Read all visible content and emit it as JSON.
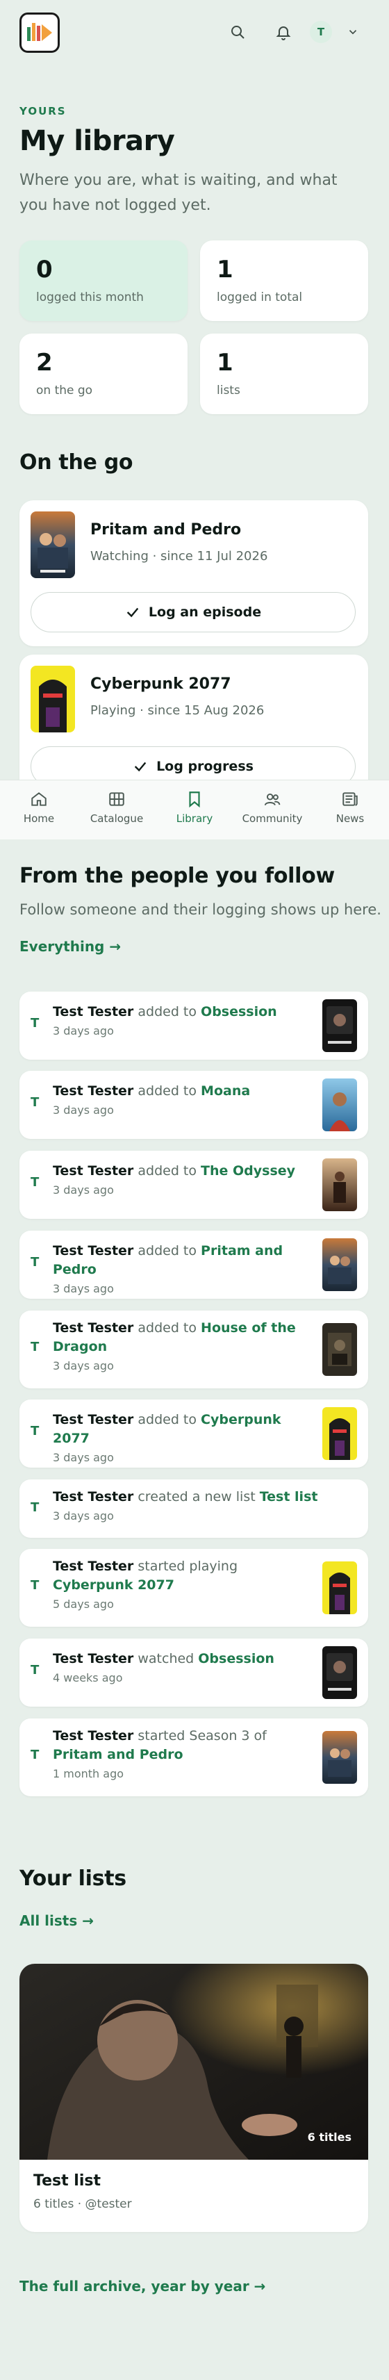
{
  "header": {
    "avatar_initial": "T",
    "icons": [
      "search-icon",
      "bell-icon",
      "chevron-down-icon"
    ]
  },
  "library": {
    "eyebrow": "YOURS",
    "title": "My library",
    "intro": "Where you are, what is waiting, and what you have not logged yet.",
    "stats": [
      {
        "value": "0",
        "label": "logged this month"
      },
      {
        "value": "1",
        "label": "logged in total"
      },
      {
        "value": "2",
        "label": "on the go"
      },
      {
        "value": "1",
        "label": "lists"
      }
    ]
  },
  "on_the_go": {
    "title": "On the go",
    "items": [
      {
        "title": "Pritam and Pedro",
        "meta": "Watching · since 11 Jul 2026",
        "button": "Log an episode"
      },
      {
        "title": "Cyberpunk 2077",
        "meta": "Playing · since 15 Aug 2026",
        "button": "Log progress"
      }
    ]
  },
  "nav": {
    "items": [
      {
        "label": "Home",
        "icon": "home-icon"
      },
      {
        "label": "Catalogue",
        "icon": "grid-icon"
      },
      {
        "label": "Library",
        "icon": "bookmark-icon"
      },
      {
        "label": "Community",
        "icon": "people-icon"
      },
      {
        "label": "News",
        "icon": "newspaper-icon"
      }
    ],
    "active": "Library"
  },
  "feed": {
    "title": "From the people you follow",
    "subtitle": "Follow someone and their logging shows up here.",
    "everything_link": "Everything →",
    "items": [
      {
        "initial": "T",
        "user": "Test Tester",
        "action": "added to",
        "object": "Obsession",
        "ago": "3 days ago"
      },
      {
        "initial": "T",
        "user": "Test Tester",
        "action": "added to",
        "object": "Moana",
        "ago": "3 days ago"
      },
      {
        "initial": "T",
        "user": "Test Tester",
        "action": "added to",
        "object": "The Odyssey",
        "ago": "3 days ago"
      },
      {
        "initial": "T",
        "user": "Test Tester",
        "action": "added to",
        "object": "Pritam and Pedro",
        "ago": "3 days ago"
      },
      {
        "initial": "T",
        "user": "Test Tester",
        "action": "added to",
        "object": "House of the Dragon",
        "ago": "3 days ago"
      },
      {
        "initial": "T",
        "user": "Test Tester",
        "action": "added to",
        "object": "Cyberpunk 2077",
        "ago": "3 days ago"
      },
      {
        "initial": "T",
        "user": "Test Tester",
        "action": "created a new list",
        "object": "Test list",
        "ago": "3 days ago"
      },
      {
        "initial": "T",
        "user": "Test Tester",
        "action": "started playing",
        "object": "Cyberpunk 2077",
        "ago": "5 days ago"
      },
      {
        "initial": "T",
        "user": "Test Tester",
        "action": "watched",
        "object": "Obsession",
        "ago": "4 weeks ago"
      },
      {
        "initial": "T",
        "user": "Test Tester",
        "action": "started Season 3 of",
        "object": "Pritam and Pedro",
        "ago": "1 month ago"
      }
    ]
  },
  "lists": {
    "title": "Your lists",
    "all_link": "All lists →",
    "card": {
      "name": "Test list",
      "meta": "6 titles · @tester",
      "count_badge": "6 titles"
    }
  },
  "footer_link": "The full archive, year by year →"
}
